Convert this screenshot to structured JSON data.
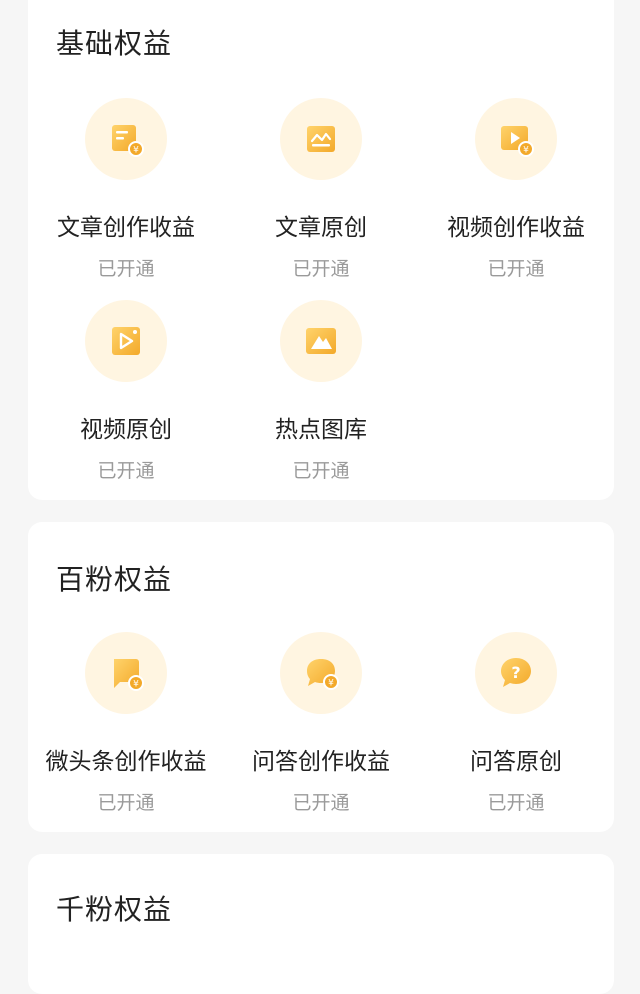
{
  "sections": [
    {
      "title": "基础权益",
      "items": [
        {
          "label": "文章创作收益",
          "status": "已开通",
          "icon": "article-income-icon"
        },
        {
          "label": "文章原创",
          "status": "已开通",
          "icon": "article-original-icon"
        },
        {
          "label": "视频创作收益",
          "status": "已开通",
          "icon": "video-income-icon"
        },
        {
          "label": "视频原创",
          "status": "已开通",
          "icon": "video-original-icon"
        },
        {
          "label": "热点图库",
          "status": "已开通",
          "icon": "image-library-icon"
        }
      ]
    },
    {
      "title": "百粉权益",
      "items": [
        {
          "label": "微头条创作收益",
          "status": "已开通",
          "icon": "micro-post-income-icon"
        },
        {
          "label": "问答创作收益",
          "status": "已开通",
          "icon": "qa-income-icon"
        },
        {
          "label": "问答原创",
          "status": "已开通",
          "icon": "qa-original-icon"
        }
      ]
    },
    {
      "title": "千粉权益",
      "items": []
    }
  ],
  "colors": {
    "icon_light": "#ffd36b",
    "icon_dark": "#f3a92a",
    "icon_bg": "#fff5e1",
    "status_text": "#9a9a9a"
  }
}
